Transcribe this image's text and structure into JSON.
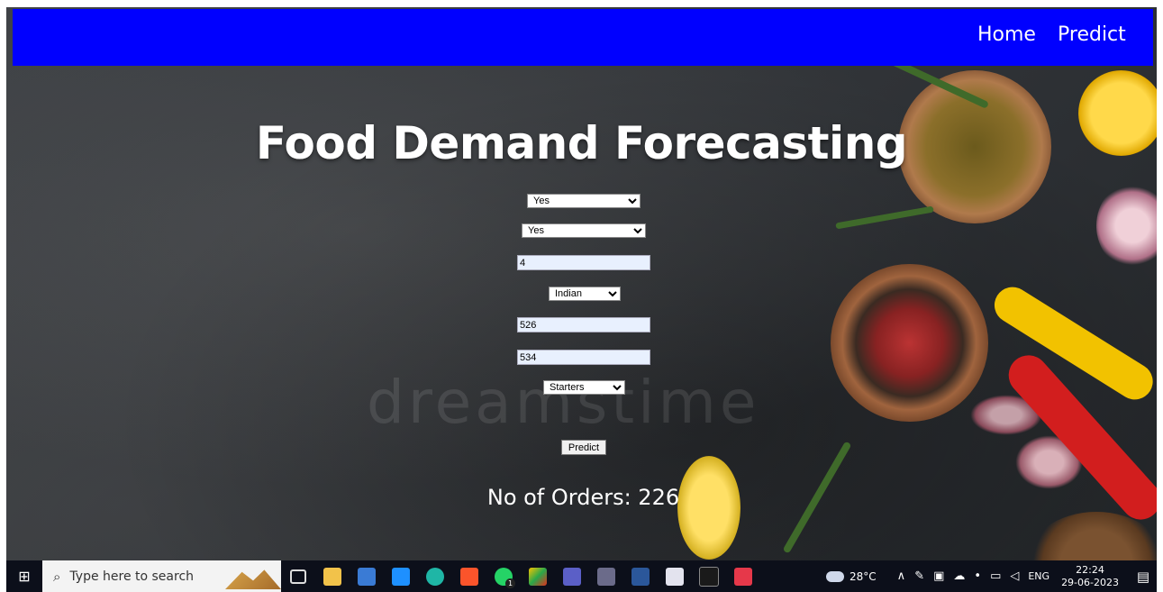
{
  "nav": {
    "links": [
      "Home",
      "Predict"
    ]
  },
  "title": "Food Demand Forecasting",
  "form": {
    "emailer_for_promotion": "Yes",
    "homepage_featured": "Yes",
    "op_area": "4",
    "cuisine": "Indian",
    "city_code": "526",
    "region_code": "534",
    "category": "Starters",
    "submit_label": "Predict"
  },
  "result": "No of Orders: 226",
  "watermark": "dreamstime",
  "taskbar": {
    "search_placeholder": "Type here to search",
    "weather_temp": "28°C",
    "language": "ENG",
    "time": "22:24",
    "date": "29-06-2023",
    "whatsapp_badge": "1"
  }
}
